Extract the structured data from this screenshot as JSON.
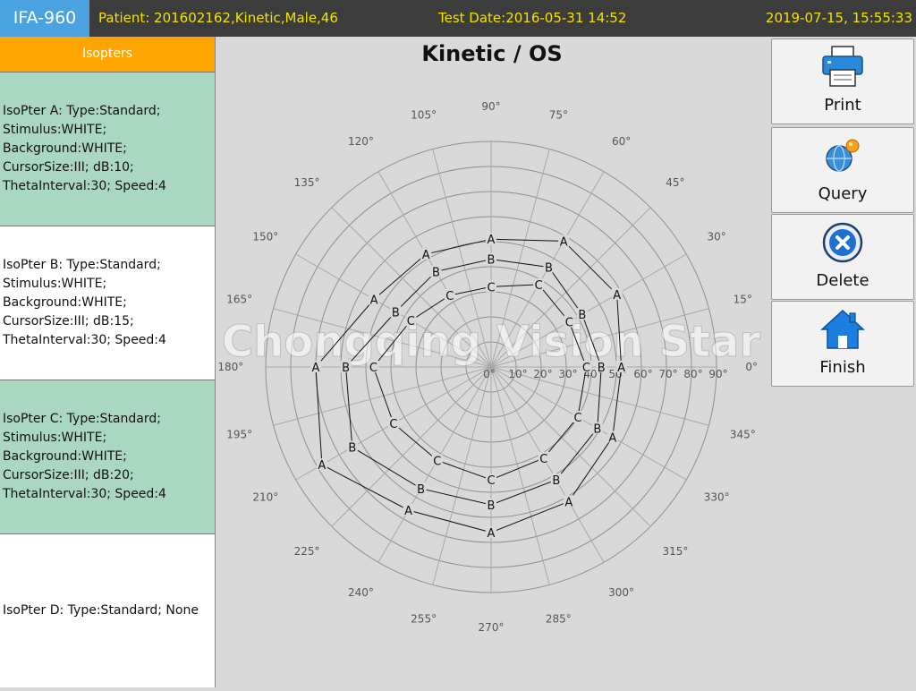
{
  "topbar": {
    "brand": "IFA-960",
    "patient": "Patient: 201602162,Kinetic,Male,46",
    "test_date": "Test Date:2016-05-31 14:52",
    "clock": "2019-07-15, 15:55:33"
  },
  "left_panel": {
    "header": "Isopters",
    "isopters": [
      {
        "text": "IsoPter A:  Type:Standard;\nStimulus:WHITE;\nBackground:WHITE;\nCursorSize:III; dB:10;\nThetaInterval:30; Speed:4"
      },
      {
        "text": "IsoPter B:  Type:Standard;\nStimulus:WHITE;\nBackground:WHITE;\nCursorSize:III; dB:15;\nThetaInterval:30; Speed:4"
      },
      {
        "text": "IsoPter C:  Type:Standard;\nStimulus:WHITE;\nBackground:WHITE;\nCursorSize:III; dB:20;\nThetaInterval:30; Speed:4"
      },
      {
        "text": "IsoPter D:  Type:Standard; None"
      }
    ]
  },
  "chart": {
    "title": "Kinetic / OS",
    "watermark": "Chongqing Vision Star",
    "angle_labels": [
      "0°",
      "15°",
      "30°",
      "45°",
      "60°",
      "75°",
      "90°",
      "105°",
      "120°",
      "135°",
      "150°",
      "165°",
      "180°",
      "195°",
      "210°",
      "225°",
      "240°",
      "255°",
      "270°",
      "285°",
      "300°",
      "315°",
      "330°",
      "345°"
    ],
    "radius_labels": [
      "0°",
      "10°",
      "20°",
      "30°",
      "40°",
      "50°",
      "60°",
      "70°",
      "80°",
      "90°"
    ]
  },
  "chart_data": {
    "type": "polar",
    "title": "Kinetic / OS",
    "radial_range": [
      0,
      90
    ],
    "radial_ticks": [
      0,
      10,
      20,
      30,
      40,
      50,
      60,
      70,
      80,
      90
    ],
    "angular_ticks": [
      0,
      15,
      30,
      45,
      60,
      75,
      90,
      105,
      120,
      135,
      150,
      165,
      180,
      195,
      210,
      225,
      240,
      255,
      270,
      285,
      300,
      315,
      330,
      345
    ],
    "grid": true,
    "series": [
      {
        "name": "A",
        "points": [
          [
            0,
            52
          ],
          [
            30,
            58
          ],
          [
            60,
            58
          ],
          [
            90,
            51
          ],
          [
            120,
            52
          ],
          [
            150,
            54
          ],
          [
            180,
            70
          ],
          [
            210,
            78
          ],
          [
            240,
            66
          ],
          [
            270,
            66
          ],
          [
            300,
            62
          ],
          [
            330,
            56
          ]
        ]
      },
      {
        "name": "B",
        "points": [
          [
            0,
            44
          ],
          [
            30,
            42
          ],
          [
            60,
            46
          ],
          [
            90,
            43
          ],
          [
            120,
            44
          ],
          [
            150,
            44
          ],
          [
            180,
            58
          ],
          [
            210,
            64
          ],
          [
            240,
            56
          ],
          [
            270,
            55
          ],
          [
            300,
            52
          ],
          [
            330,
            49
          ]
        ]
      },
      {
        "name": "C",
        "points": [
          [
            0,
            38
          ],
          [
            30,
            36
          ],
          [
            60,
            38
          ],
          [
            90,
            32
          ],
          [
            120,
            33
          ],
          [
            150,
            37
          ],
          [
            180,
            47
          ],
          [
            210,
            45
          ],
          [
            240,
            43
          ],
          [
            270,
            45
          ],
          [
            300,
            42
          ],
          [
            330,
            40
          ]
        ]
      }
    ]
  },
  "buttons": {
    "print": "Print",
    "query": "Query",
    "delete": "Delete",
    "finish": "Finish"
  },
  "colors": {
    "brand_bg": "#4aa3df",
    "topbar_bg": "#3c3c3c",
    "topbar_text": "#f2e200",
    "isopter_header": "#ffa500",
    "isopter_green": "#a9d7c2",
    "delete_blue": "#1f6fd1",
    "finish_blue": "#1c7fe0"
  }
}
